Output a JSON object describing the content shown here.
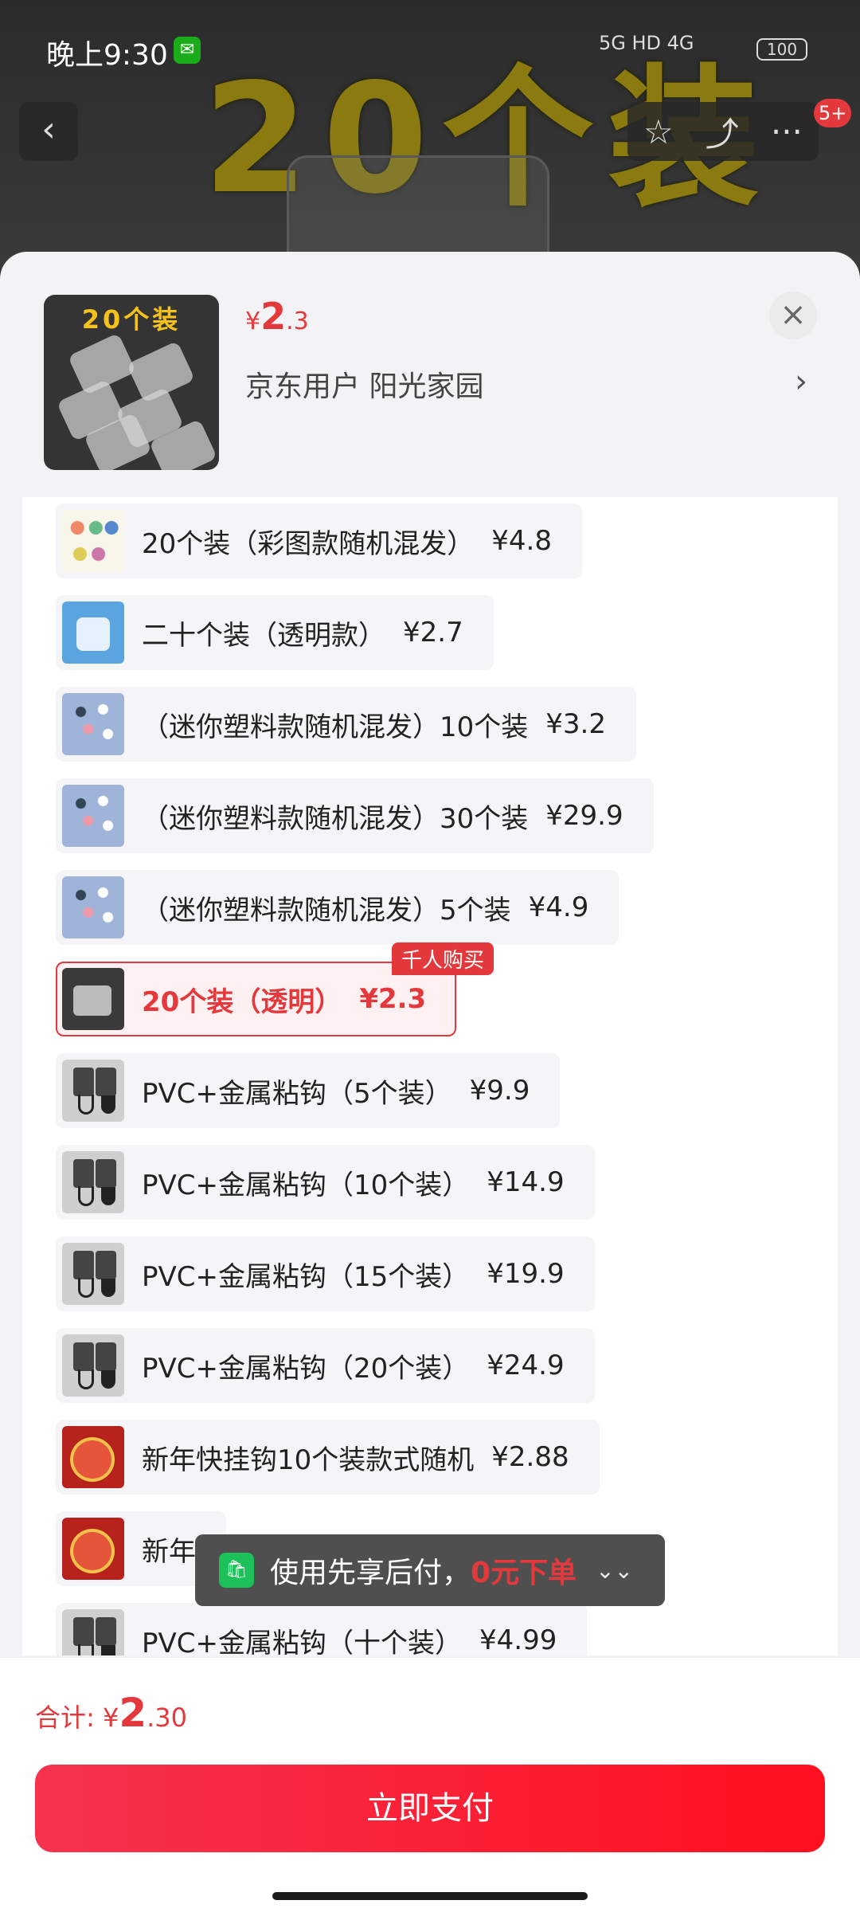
{
  "status_bar": {
    "time": "晚上9:30",
    "network": "5G  HD  4G",
    "battery": "100"
  },
  "banner": {
    "text": "20个装"
  },
  "nav": {
    "back": "‹",
    "star": "☆",
    "share": "⤴",
    "more": "···",
    "badge": "5+"
  },
  "product": {
    "thumb_title": "20个装",
    "price_yen": "¥",
    "price_int": "2",
    "price_dec": ".3",
    "address": "京东用户  阳光家园",
    "address_arrow": "›",
    "close": "×"
  },
  "options": [
    {
      "label": "20个装（彩图款随机混发）",
      "price": "¥4.8",
      "thumb": "color"
    },
    {
      "label": "二十个装（透明款）",
      "price": "¥2.7",
      "thumb": "blue"
    },
    {
      "label": "（迷你塑料款随机混发）10个装",
      "price": "¥3.2",
      "thumb": "mini"
    },
    {
      "label": "（迷你塑料款随机混发）30个装",
      "price": "¥29.9",
      "thumb": "mini"
    },
    {
      "label": "（迷你塑料款随机混发）5个装",
      "price": "¥4.9",
      "thumb": "mini"
    },
    {
      "label": "20个装（透明）",
      "price": "¥2.3",
      "thumb": "clear",
      "selected": true,
      "tag": "千人购买"
    },
    {
      "label": "PVC+金属粘钩（5个装）",
      "price": "¥9.9",
      "thumb": "pvc"
    },
    {
      "label": "PVC+金属粘钩（10个装）",
      "price": "¥14.9",
      "thumb": "pvc"
    },
    {
      "label": "PVC+金属粘钩（15个装）",
      "price": "¥19.9",
      "thumb": "pvc"
    },
    {
      "label": "PVC+金属粘钩（20个装）",
      "price": "¥24.9",
      "thumb": "pvc"
    },
    {
      "label": "新年快挂钩10个装款式随机",
      "price": "¥2.88",
      "thumb": "ny"
    },
    {
      "label": "新年",
      "price": "",
      "thumb": "ny"
    },
    {
      "label": "PVC+金属粘钩（十个装）",
      "price": "¥4.99",
      "thumb": "pvc"
    }
  ],
  "toast": {
    "text": "使用先享后付，",
    "highlight": "0元下单",
    "chevron": "⌄⌄"
  },
  "footer": {
    "total_label": "合计: ",
    "total_yen": "¥",
    "total_int": "2",
    "total_dec": ".30",
    "pay_button": "立即支付"
  },
  "colors": {
    "accent": "#e4393c",
    "pay_start": "#f5334f",
    "pay_end": "#ff0f1f"
  }
}
